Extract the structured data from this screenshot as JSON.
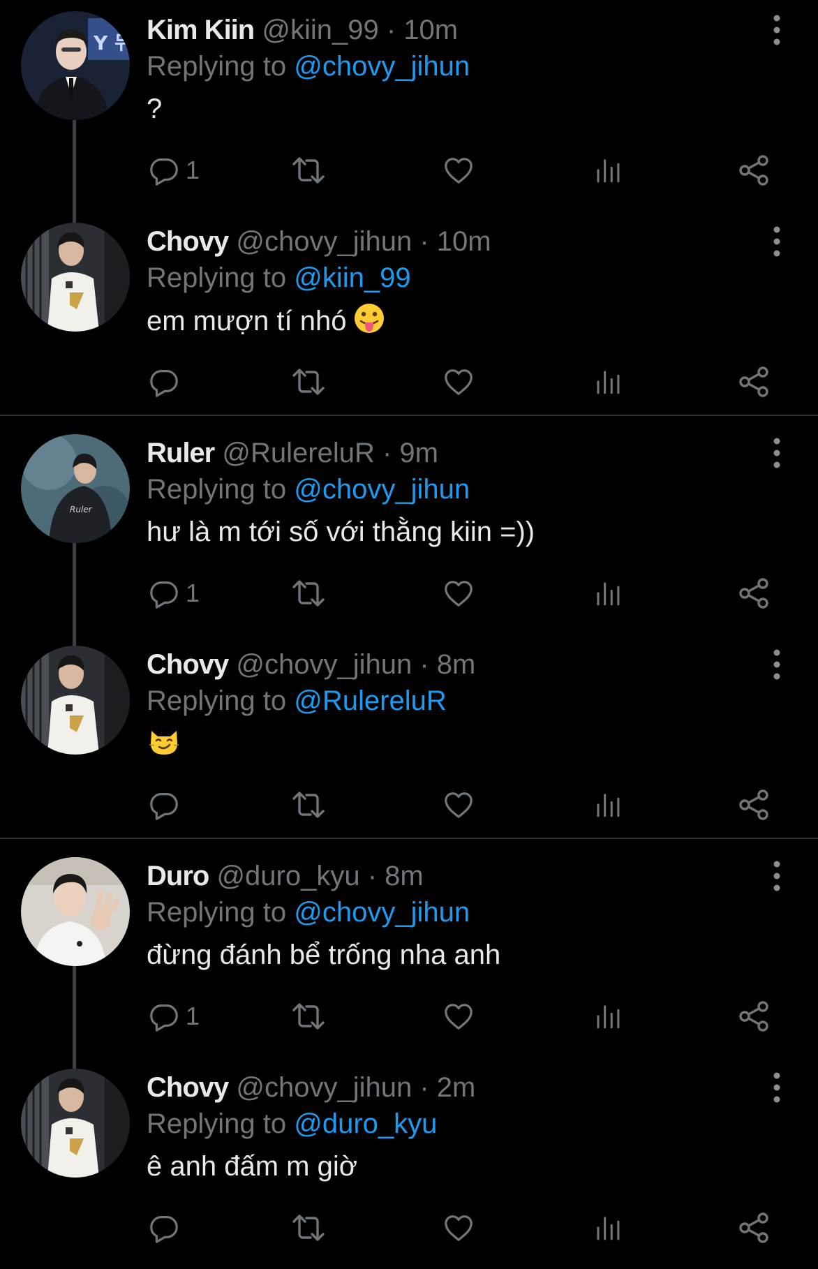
{
  "colors": {
    "background": "#000000",
    "text": "#e7e9ea",
    "muted": "#71767b",
    "link": "#1d9bf0",
    "divider": "#2f3336"
  },
  "tweets": [
    {
      "name": "Kim Kiin",
      "handle": "@kiin_99",
      "time": "· 10m",
      "replying_prefix": "Replying to",
      "replying_to": "@chovy_jihun",
      "text": "?",
      "reply_count": "1"
    },
    {
      "name": "Chovy",
      "handle": "@chovy_jihun",
      "time": "· 10m",
      "replying_prefix": "Replying to",
      "replying_to": "@kiin_99",
      "text": "em mượn tí nhó",
      "emoji": "tongue-out-emoji",
      "reply_count": ""
    },
    {
      "name": "Ruler",
      "handle": "@RulereluR",
      "time": "· 9m",
      "replying_prefix": "Replying to",
      "replying_to": "@chovy_jihun",
      "text": "hư là m tới số với thằng kiin =))",
      "reply_count": "1"
    },
    {
      "name": "Chovy",
      "handle": "@chovy_jihun",
      "time": "· 8m",
      "replying_prefix": "Replying to",
      "replying_to": "@RulereluR",
      "text": "",
      "emoji": "smirking-cat-emoji",
      "reply_count": ""
    },
    {
      "name": "Duro",
      "handle": "@duro_kyu",
      "time": "· 8m",
      "replying_prefix": "Replying to",
      "replying_to": "@chovy_jihun",
      "text": "đừng đánh bể trống nha anh",
      "reply_count": "1"
    },
    {
      "name": "Chovy",
      "handle": "@chovy_jihun",
      "time": "· 2m",
      "replying_prefix": "Replying to",
      "replying_to": "@duro_kyu",
      "text": "ê anh đấm m giờ",
      "reply_count": ""
    }
  ],
  "icons": [
    "reply-icon",
    "retweet-icon",
    "like-icon",
    "views-icon",
    "share-icon",
    "more-icon"
  ]
}
